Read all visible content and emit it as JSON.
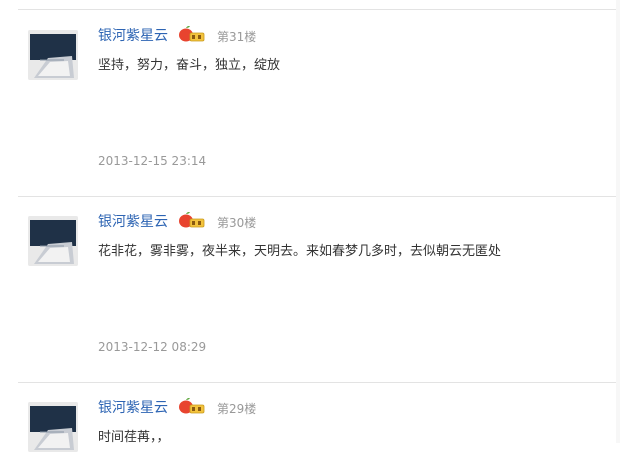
{
  "posts": [
    {
      "username": "银河紫星云",
      "floor": "第31楼",
      "content": "坚持，努力，奋斗，独立，绽放",
      "timestamp": "2013-12-15 23:14"
    },
    {
      "username": "银河紫星云",
      "floor": "第30楼",
      "content": "花非花，雾非雾，夜半来，天明去。来如春梦几多时，去似朝云无匿处",
      "timestamp": "2013-12-12 08:29"
    },
    {
      "username": "银河紫星云",
      "floor": "第29楼",
      "content": "时间荏苒，，",
      "timestamp": ""
    }
  ],
  "badge": {
    "icon": "apple-level-badge-icon",
    "colors": {
      "fruit": "#e8442f",
      "leaf": "#5aa63a",
      "tag": "#f3c33d"
    }
  },
  "colors": {
    "username": "#2d64b3",
    "meta": "#999999",
    "text": "#333333",
    "divider": "#e3e3e3"
  }
}
